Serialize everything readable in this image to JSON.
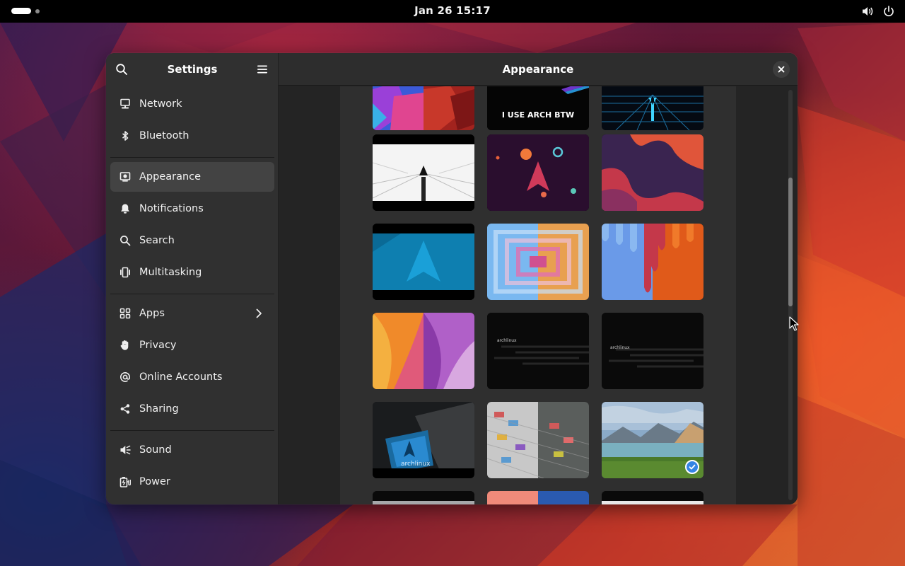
{
  "topbar": {
    "clock": "Jan 26  15:17",
    "icons": [
      "volume-icon",
      "power-icon"
    ]
  },
  "settings_window": {
    "sidebar": {
      "title": "Settings",
      "groups": [
        [
          {
            "label": "Network",
            "icon": "network-icon"
          },
          {
            "label": "Bluetooth",
            "icon": "bluetooth-icon"
          }
        ],
        [
          {
            "label": "Appearance",
            "icon": "appearance-icon",
            "selected": true
          },
          {
            "label": "Notifications",
            "icon": "bell-icon"
          },
          {
            "label": "Search",
            "icon": "search-icon"
          },
          {
            "label": "Multitasking",
            "icon": "multitasking-icon"
          }
        ],
        [
          {
            "label": "Apps",
            "icon": "apps-icon",
            "has_submenu": true
          },
          {
            "label": "Privacy",
            "icon": "hand-icon"
          },
          {
            "label": "Online Accounts",
            "icon": "at-icon"
          },
          {
            "label": "Sharing",
            "icon": "share-icon"
          }
        ],
        [
          {
            "label": "Sound",
            "icon": "speaker-icon"
          },
          {
            "label": "Power",
            "icon": "power-plug-icon"
          }
        ]
      ]
    },
    "content": {
      "title": "Appearance",
      "wallpapers": [
        {
          "name": "colorful-hexagons"
        },
        {
          "name": "i-use-arch-btw",
          "caption": "I USE ARCH BTW"
        },
        {
          "name": "neon-grid-arch"
        },
        {
          "name": "white-arch-perspective"
        },
        {
          "name": "space-arch-planets"
        },
        {
          "name": "purple-orange-waves"
        },
        {
          "name": "blue-arch-logo"
        },
        {
          "name": "pastel-spiral"
        },
        {
          "name": "blue-orange-drips"
        },
        {
          "name": "orange-purple-curves"
        },
        {
          "name": "archlinux-dark-1",
          "caption": "archlinux"
        },
        {
          "name": "archlinux-dark-2",
          "caption": "archlinux"
        },
        {
          "name": "arch-crt-monitor",
          "caption": "archlinux"
        },
        {
          "name": "isometric-keys"
        },
        {
          "name": "mountain-lake",
          "selected": true
        },
        {
          "name": "gray-partial"
        },
        {
          "name": "pink-blue-partial"
        },
        {
          "name": "white-partial"
        }
      ]
    }
  }
}
